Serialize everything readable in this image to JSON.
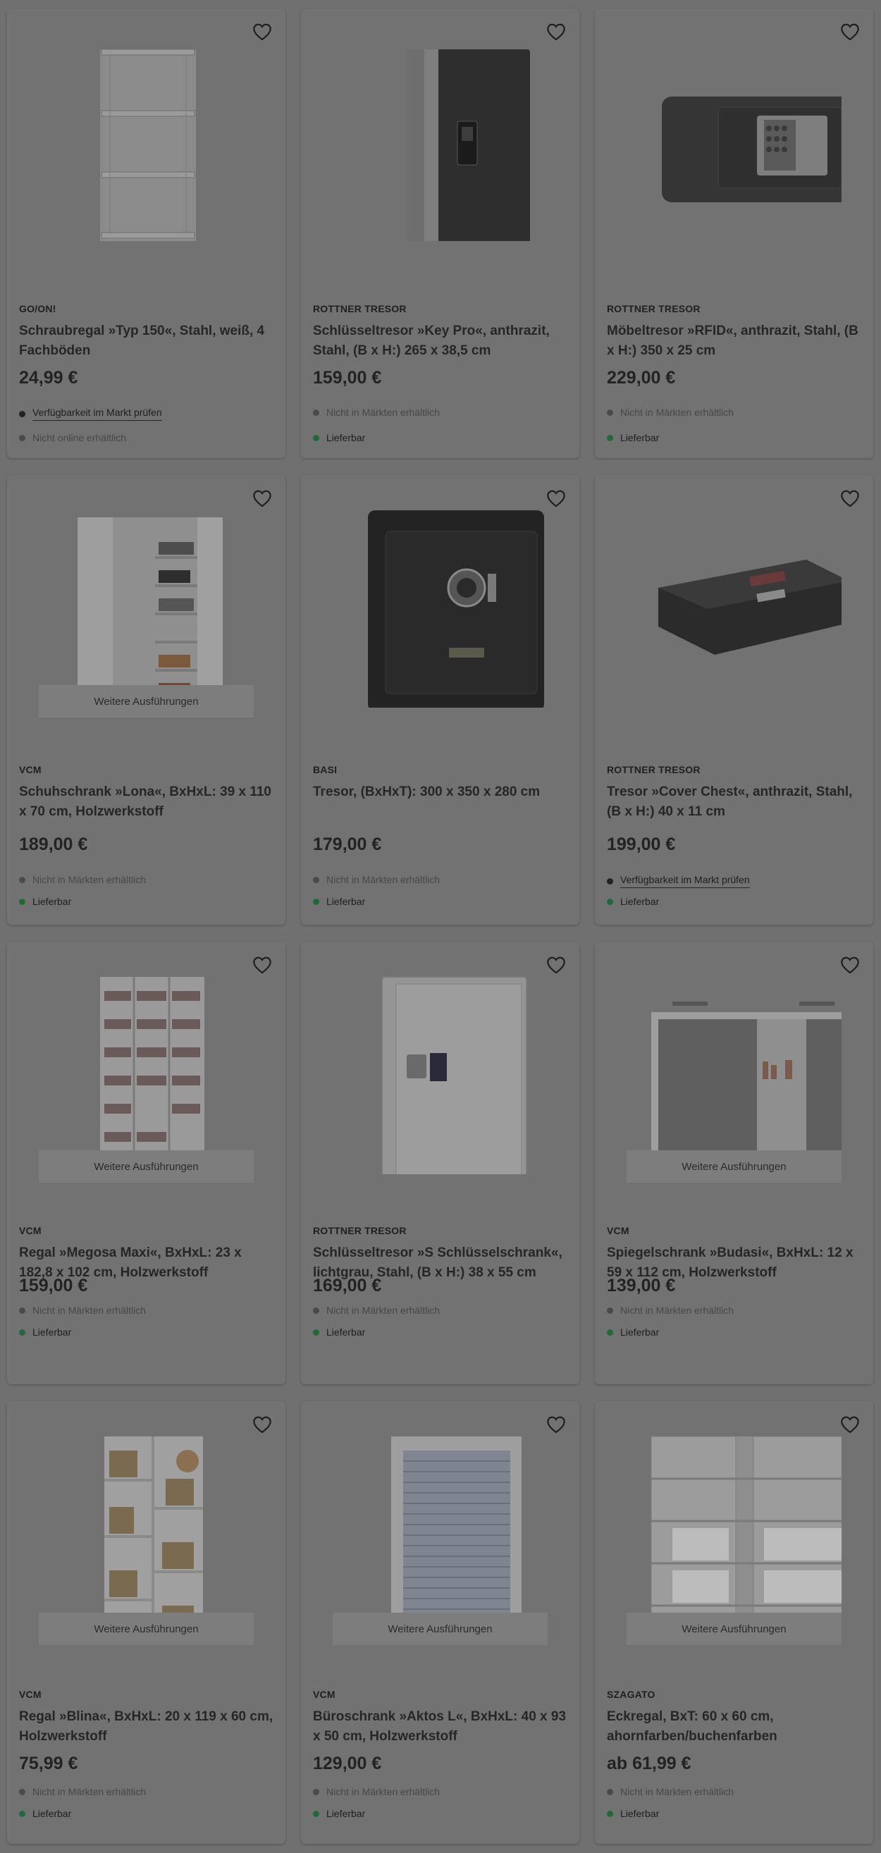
{
  "colors": {
    "page_bg": "#707070",
    "card_bg": "#727272",
    "dot_grey": "#4a4a4a",
    "dot_green": "#1e6b3a"
  },
  "variants_label": "Weitere Ausführungen",
  "wishlist_icon": "heart-outline-icon",
  "products": [
    {
      "brand": "GO/ON!",
      "title": "Schraubregal »Typ 150«, Stahl, weiß, 4 Fachböden",
      "price": "24,99 €",
      "store": "Verfügbarkeit im Markt prüfen",
      "store_type": "link",
      "online": "Nicht online erhältlich",
      "online_type": "grey",
      "image": "shelf-icon",
      "variants": false
    },
    {
      "brand": "ROTTNER TRESOR",
      "title": "Schlüsseltresor »Key Pro«, anthrazit, Stahl, (B x H:) 265 x 38,5 cm",
      "price": "159,00 €",
      "store": "Nicht in Märkten erhältlich",
      "store_type": "grey",
      "online": "Lieferbar",
      "online_type": "green",
      "image": "key-safe-icon",
      "variants": false
    },
    {
      "brand": "ROTTNER TRESOR",
      "title": "Möbeltresor »RFID«, anthrazit, Stahl, (B x H:) 350 x 25 cm",
      "price": "229,00 €",
      "store": "Nicht in Märkten erhältlich",
      "store_type": "grey",
      "online": "Lieferbar",
      "online_type": "green",
      "image": "furniture-safe-icon",
      "variants": false
    },
    {
      "brand": "VCM",
      "title": "Schuhschrank »Lona«, BxHxL: 39 x 110 x 70 cm, Holzwerkstoff",
      "price": "189,00 €",
      "store": "Nicht in Märkten erhältlich",
      "store_type": "grey",
      "online": "Lieferbar",
      "online_type": "green",
      "image": "shoe-cabinet-icon",
      "variants": true
    },
    {
      "brand": "BASI",
      "title": "Tresor, (BxHxT): 300 x 350 x 280 cm",
      "price": "179,00 €",
      "store": "Nicht in Märkten erhältlich",
      "store_type": "grey",
      "online": "Lieferbar",
      "online_type": "green",
      "image": "safe-icon",
      "variants": false
    },
    {
      "brand": "ROTTNER TRESOR",
      "title": "Tresor »Cover Chest«, anthrazit, Stahl, (B x H:) 40 x 11 cm",
      "price": "199,00 €",
      "store": "Verfügbarkeit im Markt prüfen",
      "store_type": "link",
      "online": "Lieferbar",
      "online_type": "green",
      "image": "chest-safe-icon",
      "variants": false
    },
    {
      "brand": "VCM",
      "title": "Regal »Megosa Maxi«, BxHxL: 23 x 182,8 x 102 cm, Holzwerkstoff",
      "price": "159,00 €",
      "store": "Nicht in Märkten erhältlich",
      "store_type": "grey",
      "online": "Lieferbar",
      "online_type": "green",
      "image": "media-shelf-icon",
      "variants": true
    },
    {
      "brand": "ROTTNER TRESOR",
      "title": "Schlüsseltresor »S Schlüsselschrank«, lichtgrau, Stahl, (B x H:) 38 x 55 cm",
      "price": "169,00 €",
      "store": "Nicht in Märkten erhältlich",
      "store_type": "grey",
      "online": "Lieferbar",
      "online_type": "green",
      "image": "key-cabinet-icon",
      "variants": false
    },
    {
      "brand": "VCM",
      "title": "Spiegelschrank »Budasi«, BxHxL: 12 x 59 x 112 cm, Holzwerkstoff",
      "price": "139,00 €",
      "store": "Nicht in Märkten erhältlich",
      "store_type": "grey",
      "online": "Lieferbar",
      "online_type": "green",
      "image": "mirror-cabinet-icon",
      "variants": true
    },
    {
      "brand": "VCM",
      "title": "Regal »Blina«, BxHxL: 20 x 119 x 60 cm, Holzwerkstoff",
      "price": "75,99 €",
      "store": "Nicht in Märkten erhältlich",
      "store_type": "grey",
      "online": "Lieferbar",
      "online_type": "green",
      "image": "bookshelf-icon",
      "variants": true
    },
    {
      "brand": "VCM",
      "title": "Büroschrank »Aktos L«, BxHxL: 40 x 93 x 50 cm, Holzwerkstoff",
      "price": "129,00 €",
      "store": "Nicht in Märkten erhältlich",
      "store_type": "grey",
      "online": "Lieferbar",
      "online_type": "green",
      "image": "roller-cabinet-icon",
      "variants": true
    },
    {
      "brand": "SZAGATO",
      "title": "Eckregal, BxT: 60 x 60 cm, ahornfarben/buchenfarben",
      "price": "ab 61,99 €",
      "store": "Nicht in Märkten erhältlich",
      "store_type": "grey",
      "online": "Lieferbar",
      "online_type": "green",
      "image": "corner-shelf-icon",
      "variants": true
    }
  ]
}
